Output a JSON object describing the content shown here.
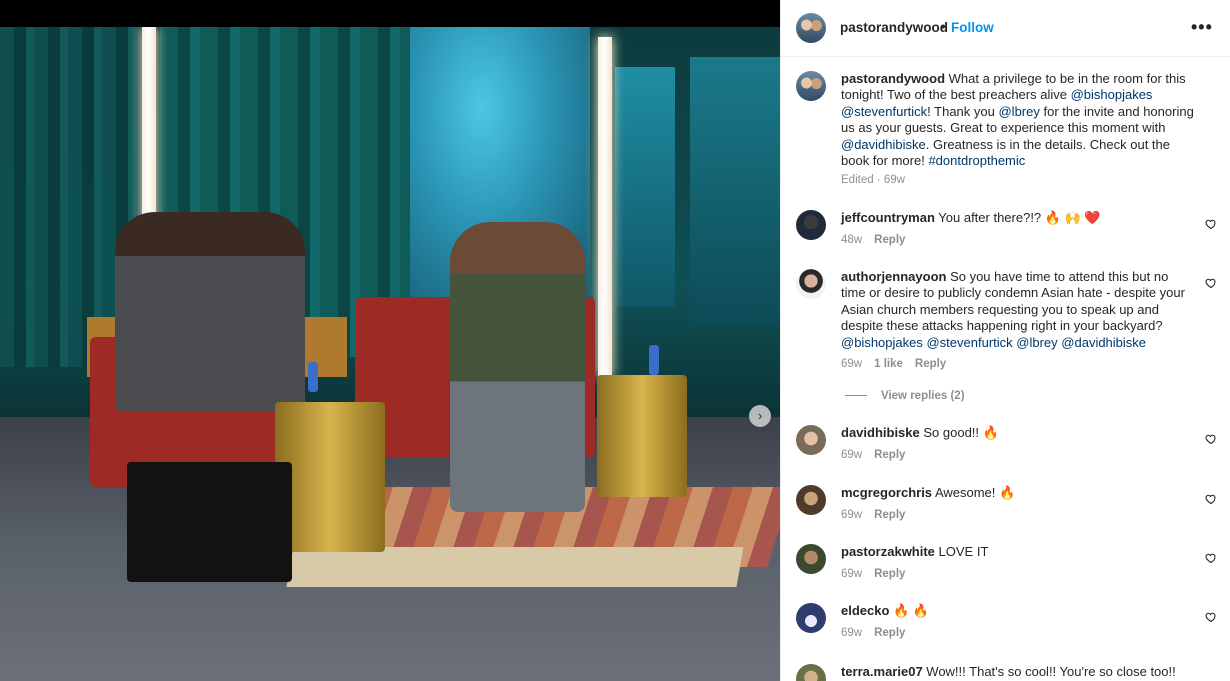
{
  "post": {
    "username": "pastorandywood",
    "follow_label": "Follow",
    "separator": "•",
    "more_label": "•••",
    "caption": {
      "username": "pastorandywood",
      "parts": [
        {
          "text": " What a privilege to be in the room for this tonight! Two of the best preachers alive ",
          "mention": false
        },
        {
          "text": "@bishopjakes",
          "mention": true
        },
        {
          "text": " ",
          "mention": false
        },
        {
          "text": "@stevenfurtick",
          "mention": true
        },
        {
          "text": "! Thank you ",
          "mention": false
        },
        {
          "text": "@lbrey",
          "mention": true
        },
        {
          "text": " for the invite and honoring us as your guests. Great to experience this moment with ",
          "mention": false
        },
        {
          "text": "@davidhibiske",
          "mention": true
        },
        {
          "text": ". Greatness is in the details. Check out the book for more! ",
          "mention": false
        },
        {
          "text": "#dontdropthemic",
          "mention": true
        }
      ],
      "meta": "Edited · 69w"
    }
  },
  "comments": [
    {
      "username": "jeffcountryman",
      "text": " You after there?!? 🔥 🙌 ❤️",
      "time": "48w",
      "likes": "",
      "reply": "Reply"
    },
    {
      "username": "authorjennayoon",
      "parts": [
        {
          "text": " So you have time to attend this but no time or desire to publicly condemn Asian hate - despite your Asian church members requesting you to speak up and despite these attacks happening right in your backyard? ",
          "mention": false
        },
        {
          "text": "@bishopjakes",
          "mention": true
        },
        {
          "text": " ",
          "mention": false
        },
        {
          "text": "@stevenfurtick",
          "mention": true
        },
        {
          "text": " ",
          "mention": false
        },
        {
          "text": "@lbrey",
          "mention": true
        },
        {
          "text": " ",
          "mention": false
        },
        {
          "text": "@davidhibiske",
          "mention": true
        }
      ],
      "time": "69w",
      "likes": "1 like",
      "reply": "Reply",
      "view_replies": "View replies (2)"
    },
    {
      "username": "davidhibiske",
      "text": " So good!! 🔥",
      "time": "69w",
      "likes": "",
      "reply": "Reply"
    },
    {
      "username": "mcgregorchris",
      "text": " Awesome! 🔥",
      "time": "69w",
      "likes": "",
      "reply": "Reply"
    },
    {
      "username": "pastorzakwhite",
      "text": " LOVE IT",
      "time": "69w",
      "likes": "",
      "reply": "Reply"
    },
    {
      "username": "eldecko",
      "text": " 🔥 🔥",
      "time": "69w",
      "likes": "",
      "reply": "Reply"
    },
    {
      "username": "terra.marie07",
      "text": " Wow!!! That's so cool!! You're so close too!!",
      "time": "",
      "likes": "",
      "reply": ""
    }
  ],
  "icons": {
    "next": "chevron-right-icon",
    "heart": "heart-outline-icon",
    "more": "more-horizontal-icon"
  },
  "colors": {
    "accent": "#0095f6",
    "mention": "#00376b",
    "meta": "#8e8e8e"
  }
}
